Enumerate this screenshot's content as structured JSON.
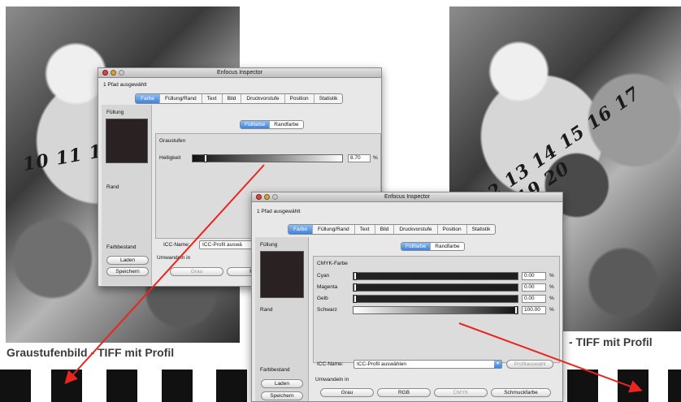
{
  "captions": {
    "left": "Graustufenbild - TIFF mit Profil",
    "right": "- TIFF mit Profil"
  },
  "photo": {
    "dial_left": "10 11 12 13 14",
    "dial_right": "12 13 14 15 16 17 18 19 20"
  },
  "window1": {
    "title": "Enfocus Inspector",
    "selection": "1 Pfad ausgewählt",
    "tabs": [
      "Farbe",
      "Füllung/Rand",
      "Text",
      "Bild",
      "Druckvorstufe",
      "Position",
      "Statistik"
    ],
    "sidebar": {
      "fill_label": "Füllung",
      "stroke_label": "Rand",
      "inventory_label": "Farbbestand",
      "load_button": "Laden",
      "save_button": "Speichern"
    },
    "segment": [
      "Füllfarbe",
      "Randfarbe"
    ],
    "group_title": "Graustufen",
    "slider": {
      "label": "Helligkeit",
      "value": "8.70",
      "unit": "%"
    },
    "icc_label": "ICC-Name:",
    "icc_select": "ICC-Profil auswä",
    "convert_label": "Umwandeln in",
    "convert_buttons": [
      "Grau",
      "RG"
    ]
  },
  "window2": {
    "title": "Enfocus Inspector",
    "selection": "1 Pfad ausgewählt",
    "tabs": [
      "Farbe",
      "Füllung/Rand",
      "Text",
      "Bild",
      "Druckvorstufe",
      "Position",
      "Statistik"
    ],
    "sidebar": {
      "fill_label": "Füllung",
      "stroke_label": "Rand",
      "inventory_label": "Farbbestand",
      "load_button": "Laden",
      "save_button": "Speichern"
    },
    "segment": [
      "Füllfarbe",
      "Randfarbe"
    ],
    "group_title": "CMYK-Farbe",
    "sliders": [
      {
        "label": "Cyan",
        "value": "0.00",
        "unit": "%",
        "level": 0.0
      },
      {
        "label": "Magenta",
        "value": "0.00",
        "unit": "%",
        "level": 0.0
      },
      {
        "label": "Gelb",
        "value": "0.00",
        "unit": "%",
        "level": 0.0
      },
      {
        "label": "Schwarz",
        "value": "100.00",
        "unit": "%",
        "level": 1.0
      }
    ],
    "icc_label": "ICC-Name:",
    "icc_select": "ICC-Profil auswählen",
    "profile_button": "Profilauswahl",
    "convert_label": "Umwandeln in",
    "convert_buttons": [
      "Grau",
      "RGB",
      "CMYK",
      "Schmuckfarbe"
    ]
  },
  "colors": {
    "arrow": "#e8251f",
    "tab_active": "#3d82dc",
    "swatch": "#2a2222"
  },
  "icons": [
    "close-light-icon",
    "minimize-light-icon",
    "zoom-light-icon",
    "select-arrow-icon",
    "red-arrow-icon"
  ]
}
